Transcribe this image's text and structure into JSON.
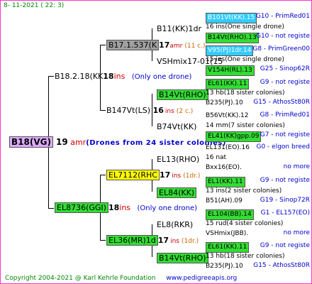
{
  "header": "8- 11-2021 (  22:  3)",
  "footer": {
    "copyright": "Copyright 2004-2021 @ Karl Kehrle Foundation",
    "url": "www.pedigreeapis.org"
  },
  "root": {
    "name": "B18(VG)",
    "num": "19",
    "ins": "amr",
    "note": "(Drones from 24 sister colonies)"
  },
  "sire": {
    "name": "B18.2.18(KK",
    "num": "18",
    "ins": "ins",
    "note": "(Only one drone)"
  },
  "dam": {
    "name": "EL8736(GGI)",
    "num": "18",
    "ins": "ins",
    "note": "(Only one drone)"
  },
  "ss": {
    "name": "B17.1.537(K",
    "num": "17",
    "ins": "amr",
    "note": "(11 c.)"
  },
  "sd": {
    "name": "B147Vt(LS)",
    "num": "16",
    "ins": "ins",
    "note": "(2 c.)"
  },
  "ds": {
    "name": "EL7112(RHC",
    "num": "17",
    "ins": "ins",
    "note": "(1dr.)"
  },
  "dd": {
    "name": "EL36(MR)1d",
    "num": "17",
    "ins": "ins",
    "note": "(1dr.)"
  },
  "l3": [
    {
      "name": "B11(KK)1dr"
    },
    {
      "name": "VSHmix17-01(15"
    },
    {
      "name": "B14Vt(RHO)"
    },
    {
      "name": "B74Vt(KK)"
    },
    {
      "name": "EL13(RHO)"
    },
    {
      "name": "EL84(KK)"
    },
    {
      "name": "EL8(RKR)"
    },
    {
      "name": "B14Vt(RHO)"
    }
  ],
  "l4": [
    {
      "a": "B101Vt(KK).15",
      "r": "G10 - PrimRed01"
    },
    {
      "a": "16 ins(One single drone)",
      "r": ""
    },
    {
      "a": "B14Vt(RHO).13",
      "r": "G10 - not registe"
    },
    {
      "a": "V95(PJ)1dr.14",
      "r": "G8 - PrimGreen00"
    },
    {
      "a": "15 ins(One single drone)",
      "r": ""
    },
    {
      "a": "V154H(RL).13",
      "r": "G25 - Sinop62R"
    },
    {
      "a": "EL61(KK).11",
      "r": "G9 - not registe"
    },
    {
      "a": "13 hb(18 sister colonies)",
      "r": ""
    },
    {
      "a": "B235(PJ).10",
      "r": "G15 - AthosSt80R"
    },
    {
      "a": "B56Vt(KK).12",
      "r": "G8 - PrimRed01"
    },
    {
      "a": "14 mm(7 sister colonies)",
      "r": ""
    },
    {
      "a": "EL41(KK)gpp.09",
      "r": "G7 - not registe"
    },
    {
      "a": "EL131(EO).16",
      "r": "G0 - elgon breed"
    },
    {
      "a": "16 nat",
      "r": ""
    },
    {
      "a": "Bxx16(EO).",
      "r": "no more"
    },
    {
      "a": "EL1(KK).11",
      "r": "G9 - not registe"
    },
    {
      "a": "13 ins(2 sister colonies)",
      "r": ""
    },
    {
      "a": "B51(AH).09",
      "r": "G19 - Sinop72R"
    },
    {
      "a": "EL104(BB).14",
      "r": "G1 - EL157(EO)"
    },
    {
      "a": "15 rud(4 sister colonies)",
      "r": ""
    },
    {
      "a": "VSHmix(JBB).",
      "r": "no more"
    },
    {
      "a": "EL61(KK).11",
      "r": "G9 - not registe"
    },
    {
      "a": "13 hb(18 sister colonies)",
      "r": ""
    },
    {
      "a": "B235(PJ).10",
      "r": "G15 - AthosSt80R"
    }
  ]
}
